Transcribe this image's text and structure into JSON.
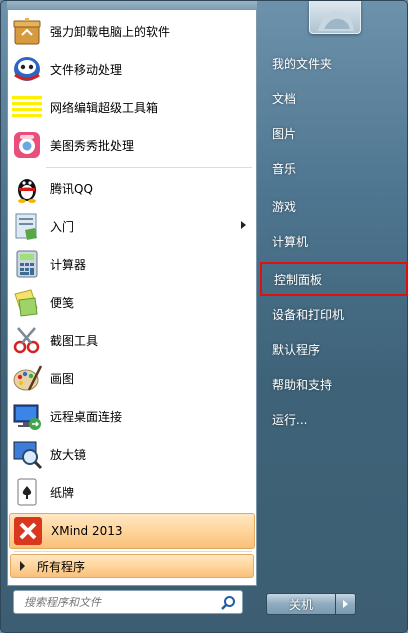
{
  "left_menu": {
    "pinned": [
      {
        "label": "强力卸载电脑上的软件",
        "icon": "uninstall-box-icon"
      },
      {
        "label": "文件移动处理",
        "icon": "file-move-icon"
      },
      {
        "label": "网络编辑超级工具箱",
        "icon": "toolbox-stripes-icon"
      },
      {
        "label": "美图秀秀批处理",
        "icon": "meitu-icon"
      }
    ],
    "recent": [
      {
        "label": "腾讯QQ",
        "icon": "qq-penguin-icon"
      },
      {
        "label": "入门",
        "icon": "getting-started-icon",
        "has_submenu": true
      },
      {
        "label": "计算器",
        "icon": "calculator-icon"
      },
      {
        "label": "便笺",
        "icon": "sticky-notes-icon"
      },
      {
        "label": "截图工具",
        "icon": "snipping-tool-icon"
      },
      {
        "label": "画图",
        "icon": "paint-icon"
      },
      {
        "label": "远程桌面连接",
        "icon": "remote-desktop-icon"
      },
      {
        "label": "放大镜",
        "icon": "magnifier-icon"
      },
      {
        "label": "纸牌",
        "icon": "solitaire-icon"
      },
      {
        "label": "XMind 2013",
        "icon": "xmind-icon",
        "highlighted": true
      }
    ],
    "all_programs": "所有程序"
  },
  "search": {
    "placeholder": "搜索程序和文件"
  },
  "right_menu": {
    "items": [
      {
        "label": "我的文件夹"
      },
      {
        "label": "文档"
      },
      {
        "label": "图片"
      },
      {
        "label": "音乐"
      },
      {
        "label": "游戏"
      },
      {
        "label": "计算机"
      },
      {
        "label": "控制面板",
        "highlighted": true
      },
      {
        "label": "设备和打印机"
      },
      {
        "label": "默认程序"
      },
      {
        "label": "帮助和支持"
      },
      {
        "label": "运行..."
      }
    ]
  },
  "shutdown": {
    "label": "关机"
  },
  "colors": {
    "highlight_outline": "#e01010",
    "accent_orange": "#ffd59c"
  }
}
